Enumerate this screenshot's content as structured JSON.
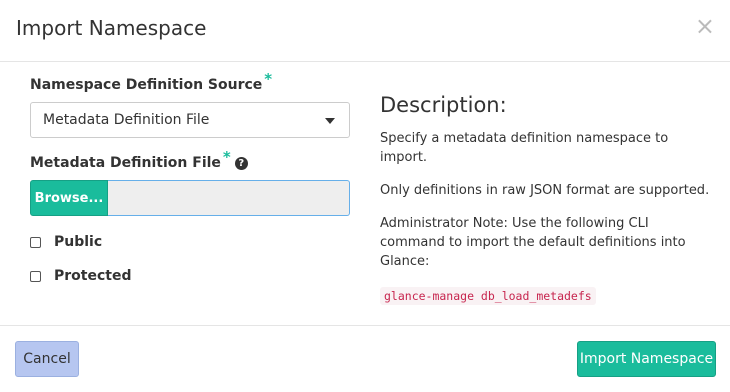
{
  "modal": {
    "title": "Import Namespace",
    "close_label": "×"
  },
  "form": {
    "source_label": "Namespace Definition Source",
    "source_required": "*",
    "source_value": "Metadata Definition File",
    "file_label": "Metadata Definition File",
    "file_required": "*",
    "help_glyph": "?",
    "browse_label": "Browse...",
    "public_label": "Public",
    "protected_label": "Protected"
  },
  "description": {
    "title": "Description:",
    "line1": "Specify a metadata definition namespace to import.",
    "line2": "Only definitions in raw JSON format are supported.",
    "line3": "Administrator Note: Use the following CLI command to import the default definitions into Glance:",
    "command": "glance-manage db_load_metadefs"
  },
  "footer": {
    "cancel_label": "Cancel",
    "import_label": "Import Namespace"
  },
  "colors": {
    "accent": "#1abc9c",
    "cancel_bg": "#b6c6f0",
    "code_text": "#c7254e"
  }
}
